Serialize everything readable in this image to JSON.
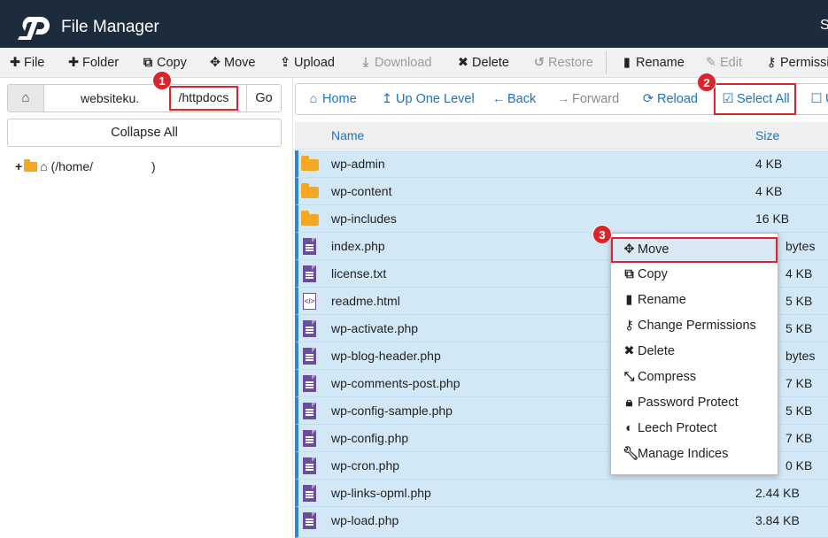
{
  "header": {
    "title": "File Manager",
    "user_initial": "S"
  },
  "toolbar": {
    "file": "File",
    "folder": "Folder",
    "copy": "Copy",
    "move": "Move",
    "upload": "Upload",
    "download": "Download",
    "delete": "Delete",
    "restore": "Restore",
    "rename": "Rename",
    "edit": "Edit",
    "permissions": "Permissi"
  },
  "path": {
    "value": "websiteku.",
    "suffix": "/httpdocs",
    "go": "Go"
  },
  "collapse_all": "Collapse All",
  "tree": {
    "root": "(/home/",
    "close": ")"
  },
  "nav": {
    "home": "Home",
    "up": "Up One Level",
    "back": "Back",
    "forward": "Forward",
    "reload": "Reload",
    "select_all": "Select All",
    "unselect": "U"
  },
  "table": {
    "headers": {
      "name": "Name",
      "size": "Size"
    },
    "rows": [
      {
        "name": "wp-admin",
        "size": "4 KB"
      },
      {
        "name": "wp-content",
        "size": "4 KB"
      },
      {
        "name": "wp-includes",
        "size": "16 KB"
      },
      {
        "name": "index.php",
        "size": "bytes"
      },
      {
        "name": "license.txt",
        "size": "4 KB"
      },
      {
        "name": "readme.html",
        "size": "5 KB"
      },
      {
        "name": "wp-activate.php",
        "size": "5 KB"
      },
      {
        "name": "wp-blog-header.php",
        "size": "bytes"
      },
      {
        "name": "wp-comments-post.php",
        "size": "7 KB"
      },
      {
        "name": "wp-config-sample.php",
        "size": "5 KB"
      },
      {
        "name": "wp-config.php",
        "size": "7 KB"
      },
      {
        "name": "wp-cron.php",
        "size": "0 KB"
      },
      {
        "name": "wp-links-opml.php",
        "size": "2.44 KB"
      },
      {
        "name": "wp-load.php",
        "size": "3.84 KB"
      }
    ]
  },
  "context_menu": {
    "move": "Move",
    "copy": "Copy",
    "rename": "Rename",
    "change_permissions": "Change Permissions",
    "delete": "Delete",
    "compress": "Compress",
    "password_protect": "Password Protect",
    "leech_protect": "Leech Protect",
    "manage_indices": "Manage Indices"
  },
  "badges": {
    "one": "1",
    "two": "2",
    "three": "3"
  },
  "colors": {
    "header": "#1d2c3d",
    "link": "#1a73c9",
    "selected_row": "#d3e8f6",
    "highlight": "#d9262c",
    "folder": "#f5a623",
    "file": "#6b4e9b"
  }
}
